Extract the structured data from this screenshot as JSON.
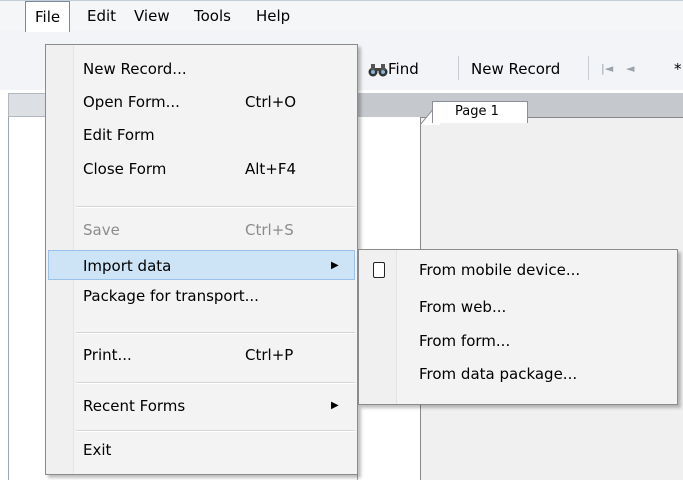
{
  "menubar": {
    "items": [
      "File",
      "Edit",
      "View",
      "Tools",
      "Help"
    ]
  },
  "toolbar": {
    "find_label": "Find",
    "new_record_label": "New Record",
    "nav_first": "|◄",
    "nav_prev": "◄",
    "overflow": "*"
  },
  "page": {
    "tab_label": "Page 1"
  },
  "file_menu": {
    "new_record": "New Record...",
    "open_form": "Open Form...",
    "open_form_sc": "Ctrl+O",
    "edit_form": "Edit Form",
    "close_form": "Close Form",
    "close_form_sc": "Alt+F4",
    "save": "Save",
    "save_sc": "Ctrl+S",
    "import_data": "Import data",
    "package": "Package for transport...",
    "print": "Print...",
    "print_sc": "Ctrl+P",
    "recent_forms": "Recent Forms",
    "exit": "Exit"
  },
  "import_submenu": {
    "mobile": "From mobile device...",
    "web": "From web...",
    "form": "From form...",
    "package": "From data package..."
  },
  "icons": {
    "find": "binoculars-icon",
    "mobile": "mobile-device-icon",
    "submenu_arrow": "submenu-arrow-icon"
  }
}
